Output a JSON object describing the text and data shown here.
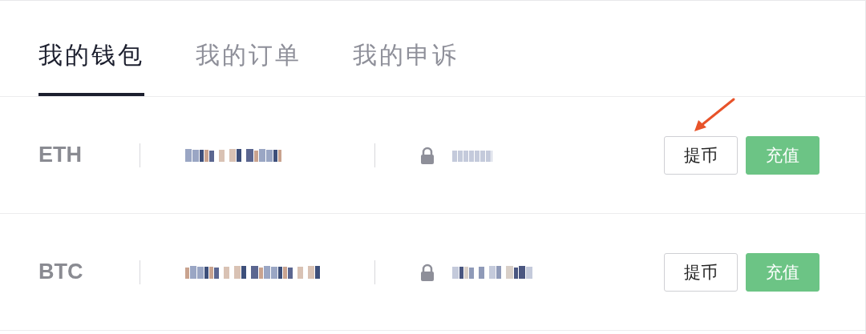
{
  "tabs": [
    {
      "label": "我的钱包",
      "selected": true
    },
    {
      "label": "我的订单",
      "selected": false
    },
    {
      "label": "我的申诉",
      "selected": false
    }
  ],
  "assets": [
    {
      "currency": "ETH",
      "locked": true,
      "buttons": [
        {
          "label": "提币",
          "kind": "outline"
        },
        {
          "label": "充值",
          "kind": "primary"
        }
      ]
    },
    {
      "currency": "BTC",
      "locked": true,
      "buttons": [
        {
          "label": "提币",
          "kind": "outline"
        },
        {
          "label": "充值",
          "kind": "primary"
        }
      ]
    }
  ]
}
